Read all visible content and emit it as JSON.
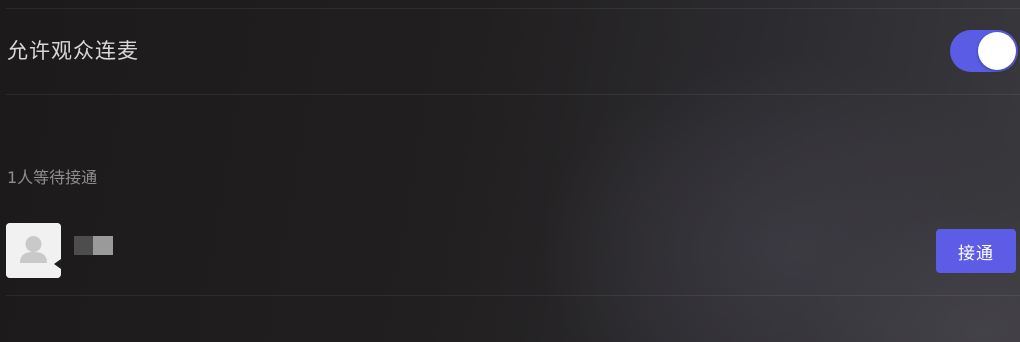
{
  "settings": {
    "allow_audience_mic_label": "允许观众连麦",
    "allow_audience_mic_enabled": true,
    "toggle_color": "#5b5ce6"
  },
  "waiting": {
    "count_label": "1人等待接通",
    "users": [
      {
        "avatar_icon": "default-user-avatar-icon",
        "connect_label": "接通"
      }
    ]
  },
  "colors": {
    "accent": "#5c5ce6",
    "background": "#211f1f"
  }
}
